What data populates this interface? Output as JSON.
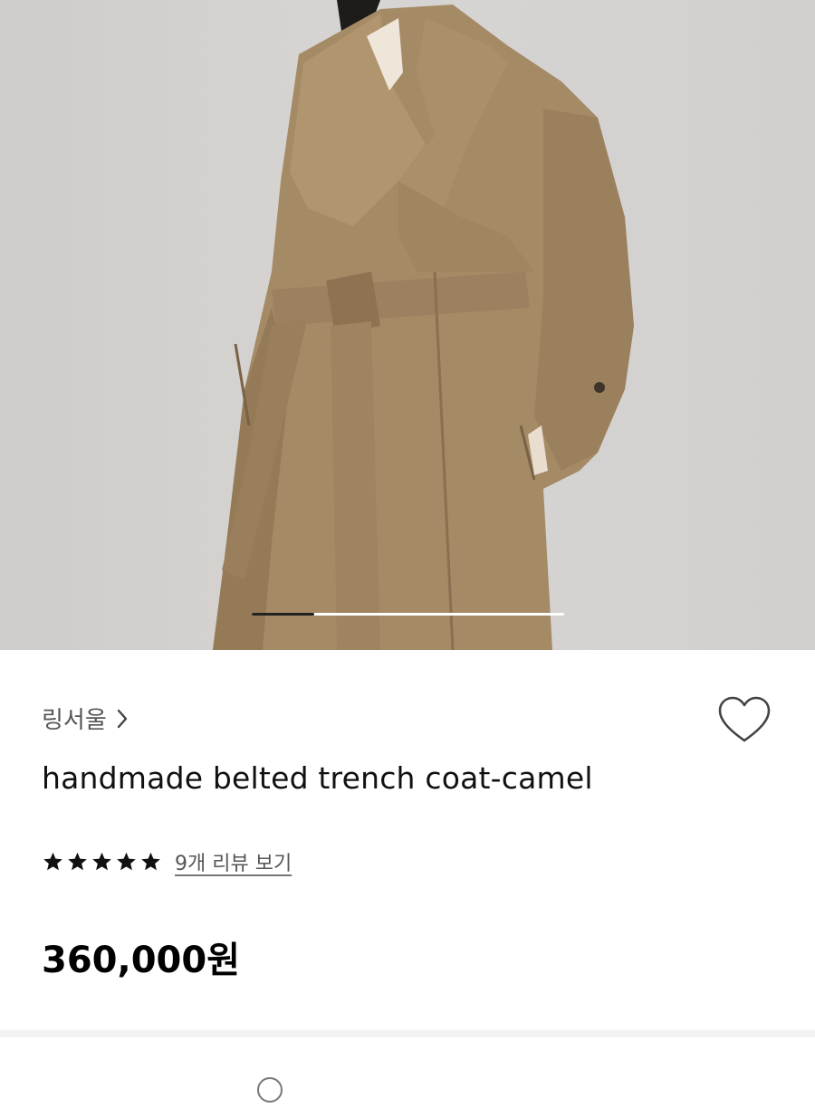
{
  "product": {
    "image_alt": "camel trench coat photo",
    "brand": "링서울",
    "title": "handmade belted trench coat-camel",
    "rating_stars": 5,
    "reviews_link": "9개 리뷰 보기",
    "price": "360,000원"
  },
  "carousel": {
    "current": 1,
    "total": 4,
    "progress": 0.2
  },
  "colors": {
    "accent": "#111111",
    "coat": "#a58a66",
    "background": "#d3d1cf"
  },
  "icons": {
    "brand_chevron": "chevron-right-icon",
    "favorite": "heart-outline-icon",
    "star": "star-icon",
    "help": "question-circle-icon"
  }
}
